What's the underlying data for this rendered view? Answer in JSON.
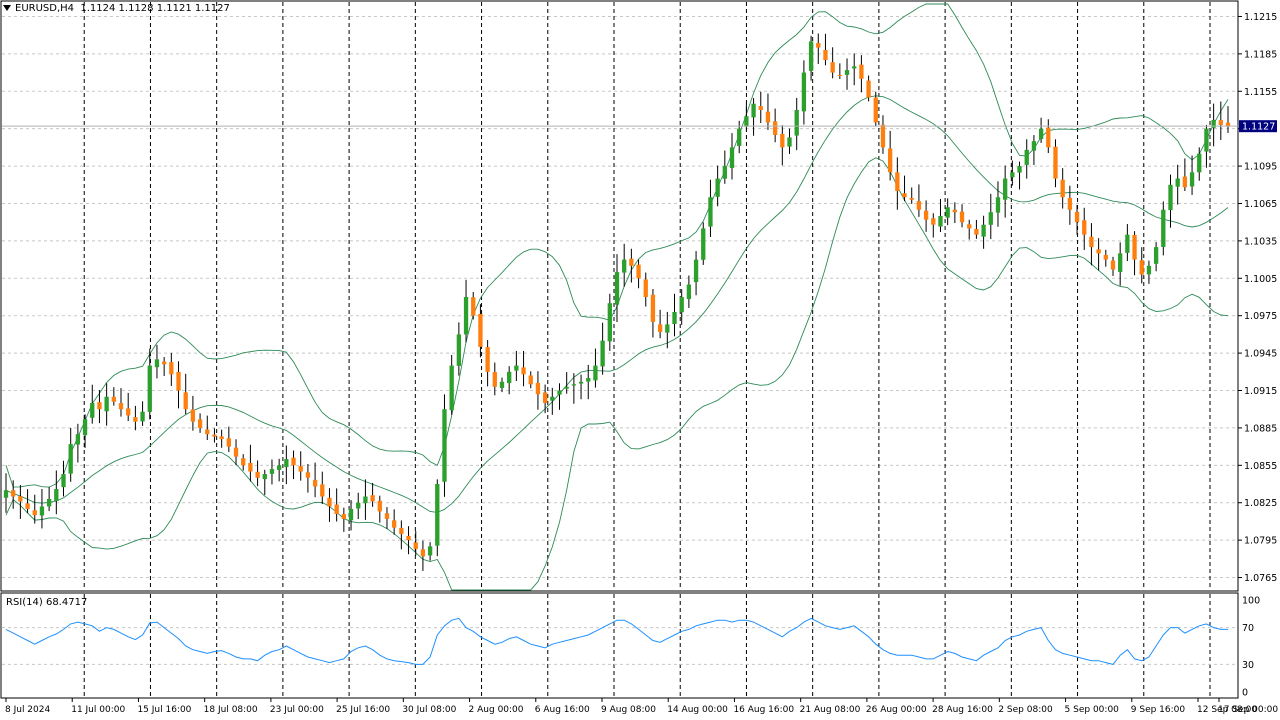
{
  "header": {
    "symbol": "EURUSD,H4",
    "ohlc": "1.1124 1.1128 1.1121 1.1127"
  },
  "rsi_header": {
    "label": "RSI(14) 68.4717"
  },
  "colors": {
    "bull": "#2ca02c",
    "bear": "#ff7f0e",
    "wick": "#000000",
    "bands": "#2e8b57",
    "rsi_line": "#1e90ff",
    "grid": "#c8c8c8",
    "separator": "#000000",
    "price_tag_bg": "#000080"
  },
  "chart_data": [
    {
      "type": "candlestick",
      "symbol": "EURUSD",
      "timeframe": "H4",
      "current_price": "1.1127",
      "ylim": [
        1.0755,
        1.1225
      ],
      "y_ticks": [
        "1.1215",
        "1.1185",
        "1.1155",
        "1.1125",
        "1.1095",
        "1.1065",
        "1.1035",
        "1.1005",
        "1.0975",
        "1.0945",
        "1.0915",
        "1.0885",
        "1.0855",
        "1.0825",
        "1.0795",
        "1.0765"
      ],
      "x_ticks": [
        "8 Jul 2024",
        "11 Jul 00:00",
        "15 Jul 16:00",
        "18 Jul 08:00",
        "23 Jul 00:00",
        "25 Jul 16:00",
        "30 Jul 08:00",
        "2 Aug 00:00",
        "6 Aug 16:00",
        "9 Aug 08:00",
        "14 Aug 00:00",
        "16 Aug 16:00",
        "21 Aug 08:00",
        "26 Aug 00:00",
        "28 Aug 16:00",
        "2 Sep 08:00",
        "5 Sep 00:00",
        "9 Sep 16:00",
        "12 Sep 08:00",
        "17 Sep 00:00"
      ],
      "series_close": [
        1.0835,
        1.083,
        1.0826,
        1.082,
        1.0815,
        1.0822,
        1.0828,
        1.0836,
        1.0848,
        1.0872,
        1.088,
        1.0892,
        1.0905,
        1.09,
        1.091,
        1.0906,
        1.09,
        1.0895,
        1.089,
        1.0898,
        1.0935,
        1.094,
        1.0936,
        1.0928,
        1.0915,
        1.09,
        1.089,
        1.0885,
        1.088,
        1.0878,
        1.0876,
        1.087,
        1.0862,
        1.0855,
        1.085,
        1.0845,
        1.0848,
        1.0852,
        1.0855,
        1.086,
        1.0855,
        1.085,
        1.0845,
        1.0838,
        1.083,
        1.0822,
        1.0816,
        1.0812,
        1.082,
        1.0825,
        1.083,
        1.0826,
        1.0818,
        1.0812,
        1.0805,
        1.08,
        1.0795,
        1.0788,
        1.0782,
        1.079,
        1.084,
        1.09,
        1.0935,
        1.096,
        1.099,
        1.0975,
        1.095,
        1.093,
        1.0918,
        1.0922,
        1.093,
        1.0935,
        1.0928,
        1.092,
        1.0912,
        1.0905,
        1.091,
        1.0915,
        1.0918,
        1.092,
        1.0922,
        1.0925,
        1.0935,
        1.0955,
        1.0985,
        1.101,
        1.102,
        1.1015,
        1.1005,
        1.099,
        1.097,
        1.0962,
        1.0968,
        1.0978,
        1.099,
        1.1,
        1.102,
        1.1045,
        1.107,
        1.1085,
        1.1095,
        1.111,
        1.1125,
        1.1135,
        1.1145,
        1.114,
        1.113,
        1.112,
        1.111,
        1.1118,
        1.114,
        1.117,
        1.1195,
        1.119,
        1.118,
        1.117,
        1.1168,
        1.1172,
        1.1175,
        1.1165,
        1.115,
        1.113,
        1.111,
        1.109,
        1.1075,
        1.107,
        1.1068,
        1.106,
        1.1052,
        1.1048,
        1.1055,
        1.1062,
        1.1058,
        1.105,
        1.1045,
        1.104,
        1.1048,
        1.1058,
        1.107,
        1.1085,
        1.109,
        1.1095,
        1.1108,
        1.1115,
        1.1125,
        1.111,
        1.1085,
        1.107,
        1.106,
        1.105,
        1.104,
        1.103,
        1.1025,
        1.102,
        1.1012,
        1.1025,
        1.104,
        1.102,
        1.1008,
        1.1015,
        1.103,
        1.106,
        1.108,
        1.1085,
        1.1078,
        1.109,
        1.1105,
        1.1125,
        1.1132,
        1.1128,
        1.1127
      ],
      "bollinger": {
        "period": 20,
        "deviation": 2
      }
    },
    {
      "type": "line",
      "name": "RSI(14)",
      "value_label": "68.4717",
      "ylim": [
        0,
        100
      ],
      "y_ticks": [
        "100",
        "70",
        "30",
        "0"
      ],
      "levels": [
        70,
        30
      ],
      "values": [
        68,
        64,
        60,
        56,
        52,
        56,
        60,
        63,
        68,
        74,
        76,
        74,
        72,
        66,
        70,
        68,
        64,
        60,
        57,
        62,
        75,
        76,
        70,
        64,
        58,
        50,
        46,
        44,
        42,
        44,
        45,
        42,
        38,
        36,
        36,
        34,
        40,
        44,
        46,
        50,
        46,
        42,
        38,
        36,
        34,
        32,
        34,
        36,
        44,
        48,
        50,
        46,
        40,
        36,
        34,
        33,
        32,
        30,
        30,
        38,
        62,
        72,
        78,
        80,
        70,
        66,
        60,
        56,
        52,
        54,
        58,
        60,
        56,
        52,
        50,
        48,
        52,
        54,
        56,
        58,
        60,
        62,
        66,
        70,
        74,
        78,
        78,
        74,
        68,
        62,
        56,
        54,
        58,
        62,
        66,
        68,
        72,
        74,
        76,
        78,
        78,
        76,
        78,
        78,
        76,
        72,
        68,
        64,
        60,
        66,
        70,
        76,
        80,
        76,
        72,
        70,
        68,
        70,
        72,
        66,
        60,
        52,
        46,
        42,
        40,
        40,
        40,
        38,
        36,
        36,
        40,
        44,
        42,
        38,
        36,
        34,
        40,
        44,
        48,
        56,
        60,
        62,
        66,
        68,
        70,
        56,
        46,
        42,
        40,
        38,
        36,
        34,
        34,
        32,
        30,
        40,
        46,
        36,
        34,
        38,
        50,
        62,
        70,
        70,
        64,
        68,
        72,
        74,
        70,
        68,
        68
      ]
    }
  ]
}
